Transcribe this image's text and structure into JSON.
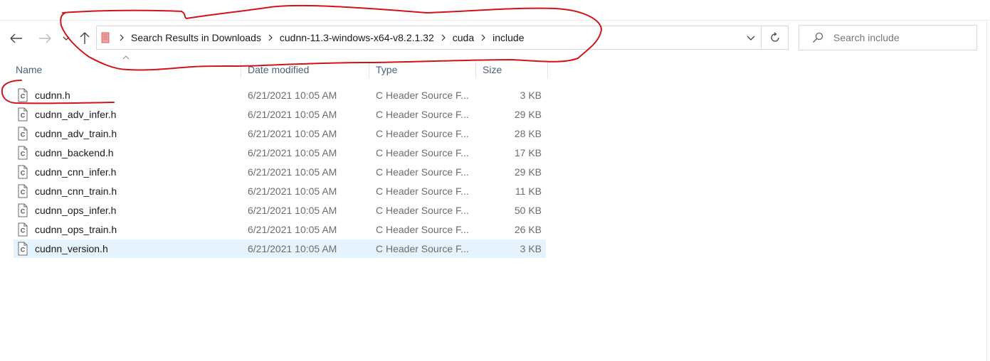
{
  "navigation": {
    "back_icon": "arrow-left-icon",
    "forward_icon": "arrow-right-icon",
    "recent_icon": "chevron-down-icon",
    "up_icon": "arrow-up-icon"
  },
  "address_bar": {
    "breadcrumbs": [
      "Search Results in Downloads",
      "cudnn-11.3-windows-x64-v8.2.1.32",
      "cuda",
      "include"
    ]
  },
  "search": {
    "placeholder": "Search include"
  },
  "columns": {
    "name": "Name",
    "date": "Date modified",
    "type": "Type",
    "size": "Size"
  },
  "files": [
    {
      "name": "cudnn.h",
      "date": "6/21/2021 10:05 AM",
      "type": "C Header Source F...",
      "size": "3 KB"
    },
    {
      "name": "cudnn_adv_infer.h",
      "date": "6/21/2021 10:05 AM",
      "type": "C Header Source F...",
      "size": "29 KB"
    },
    {
      "name": "cudnn_adv_train.h",
      "date": "6/21/2021 10:05 AM",
      "type": "C Header Source F...",
      "size": "28 KB"
    },
    {
      "name": "cudnn_backend.h",
      "date": "6/21/2021 10:05 AM",
      "type": "C Header Source F...",
      "size": "17 KB"
    },
    {
      "name": "cudnn_cnn_infer.h",
      "date": "6/21/2021 10:05 AM",
      "type": "C Header Source F...",
      "size": "29 KB"
    },
    {
      "name": "cudnn_cnn_train.h",
      "date": "6/21/2021 10:05 AM",
      "type": "C Header Source F...",
      "size": "11 KB"
    },
    {
      "name": "cudnn_ops_infer.h",
      "date": "6/21/2021 10:05 AM",
      "type": "C Header Source F...",
      "size": "50 KB"
    },
    {
      "name": "cudnn_ops_train.h",
      "date": "6/21/2021 10:05 AM",
      "type": "C Header Source F...",
      "size": "26 KB"
    },
    {
      "name": "cudnn_version.h",
      "date": "6/21/2021 10:05 AM",
      "type": "C Header Source F...",
      "size": "3 KB"
    }
  ],
  "selected_index": 8,
  "colors": {
    "selection": "#e5f3ff",
    "header_text": "#4c607a",
    "annotation": "#d0141c"
  }
}
